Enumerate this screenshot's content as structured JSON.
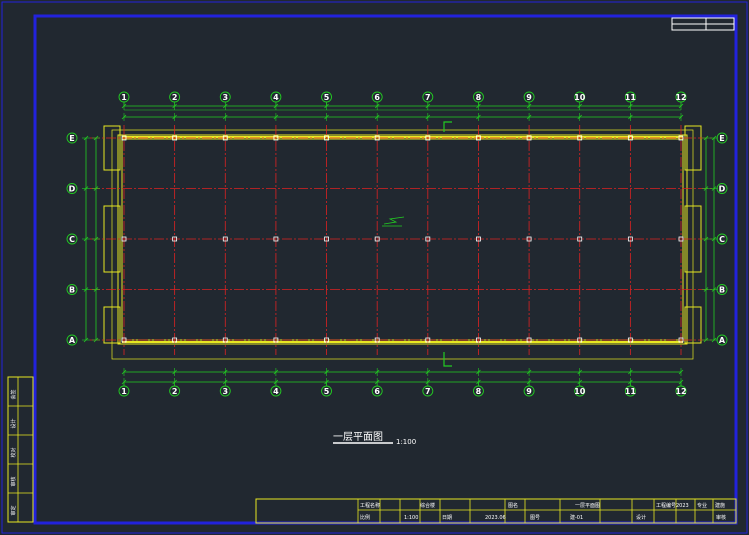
{
  "drawing": {
    "title": "一层平面图",
    "scale": "1:100",
    "grid_columns": [
      "1",
      "2",
      "3",
      "4",
      "5",
      "6",
      "7",
      "8",
      "9",
      "10",
      "11",
      "12"
    ],
    "grid_rows": [
      "E",
      "D",
      "C",
      "B",
      "A"
    ],
    "colors": {
      "background": "#212830",
      "frame": "#2222dd",
      "dimension": "#22cc22",
      "grid_line": "#dd2222",
      "wall": "#e8e822",
      "column": "#ffffff",
      "text": "#ffffff"
    }
  },
  "side_table": {
    "cells": [
      "会签",
      "设计",
      "校对",
      "审核",
      "审定"
    ]
  },
  "title_block": {
    "cells": [
      "工程名称",
      "综合楼",
      "图名",
      "一层平面图",
      "工程编号",
      "2023",
      "专业",
      "建施",
      "比例",
      "1:100",
      "日期",
      "2023.06",
      "图号",
      "建-01",
      "设计",
      "审核"
    ]
  }
}
